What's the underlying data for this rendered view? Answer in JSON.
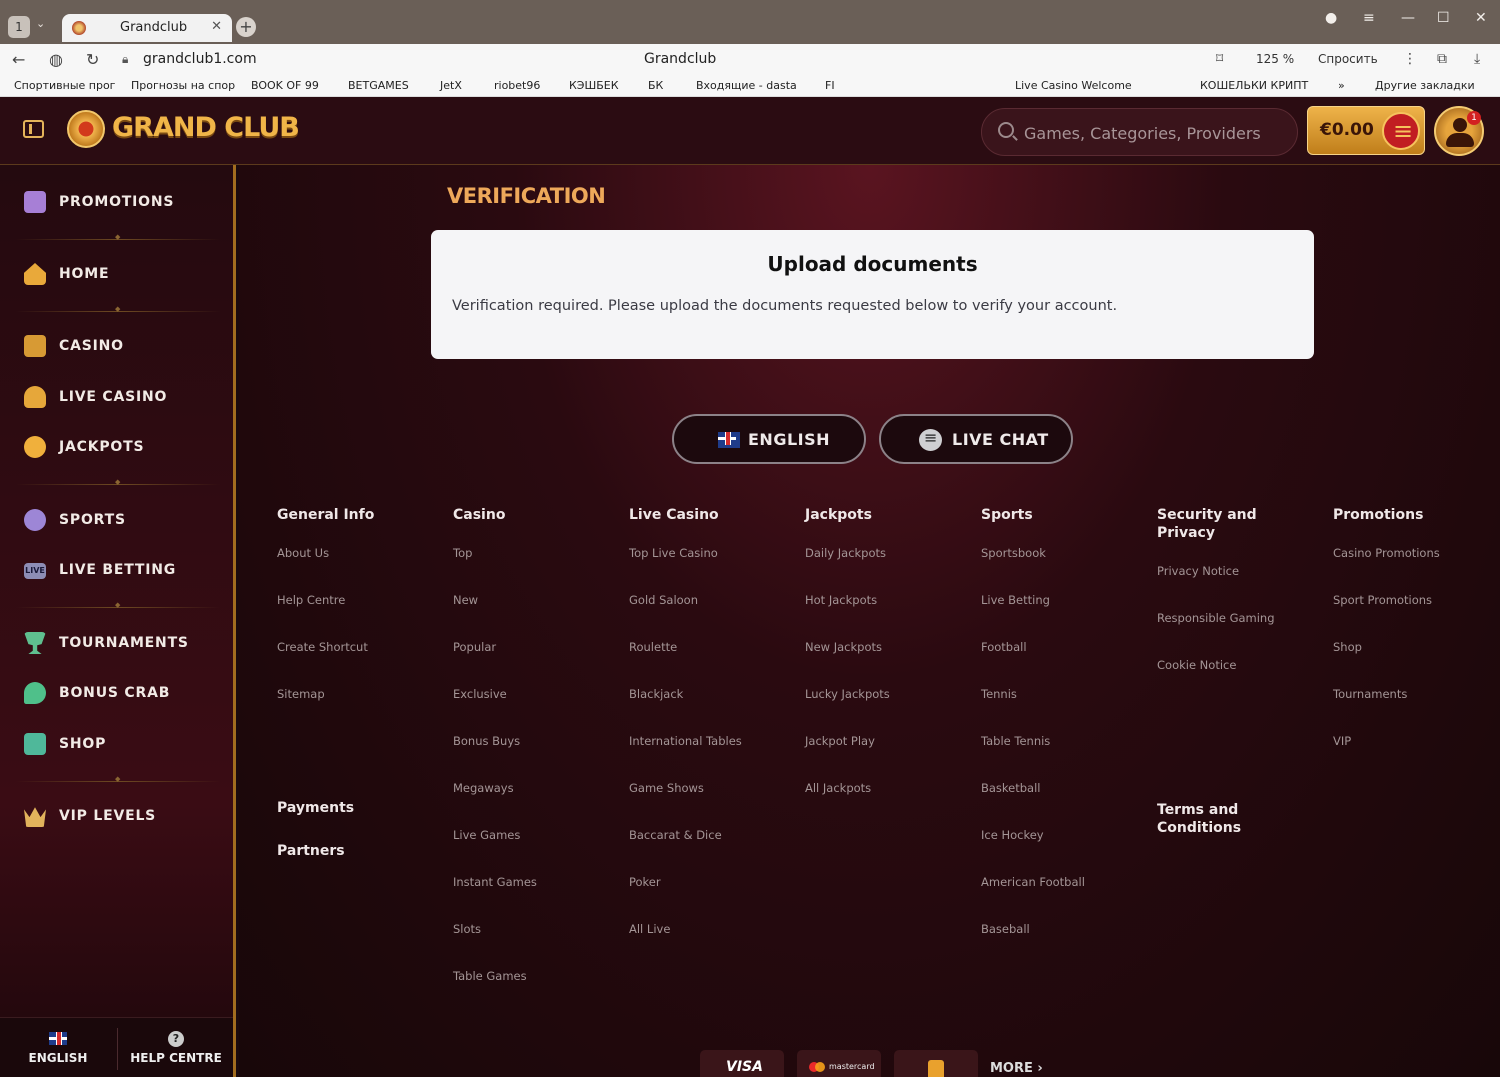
{
  "browser": {
    "tab_counter": "1",
    "tab_title": "Grandclub",
    "url": "grandclub1.com",
    "page_title": "Grandclub",
    "zoom": "125 %",
    "ask_label": "Спросить",
    "bookmarks": [
      "Спортивные прог",
      "Прогнозы на спор",
      "BOOK OF 99",
      "BETGAMES",
      "JetX",
      "riobet96",
      "КЭШБЕК",
      "БК",
      "Входящие - dasta",
      "FI",
      "Live Casino Welcome",
      "КОШЕЛЬКИ КРИПТ",
      "»",
      "Другие закладки"
    ]
  },
  "header": {
    "logo_text": "GRAND CLUB",
    "search_placeholder": "Games, Categories, Providers",
    "balance": "€0.00",
    "notification_count": "1"
  },
  "sidebar": {
    "items": [
      {
        "label": "PROMOTIONS",
        "icon": "gift-icon"
      },
      {
        "label": "HOME",
        "icon": "home-icon"
      },
      {
        "label": "CASINO",
        "icon": "slot-machine-icon"
      },
      {
        "label": "LIVE CASINO",
        "icon": "spade-icon"
      },
      {
        "label": "JACKPOTS",
        "icon": "clover-icon"
      },
      {
        "label": "SPORTS",
        "icon": "soccer-ball-icon"
      },
      {
        "label": "LIVE BETTING",
        "icon": "live-icon"
      },
      {
        "label": "TOURNAMENTS",
        "icon": "trophy-icon"
      },
      {
        "label": "BONUS CRAB",
        "icon": "crab-icon"
      },
      {
        "label": "SHOP",
        "icon": "shop-icon"
      },
      {
        "label": "VIP LEVELS",
        "icon": "crown-icon"
      }
    ],
    "live_badge": "LIVE",
    "footer_language": "ENGLISH",
    "footer_help": "HELP CENTRE",
    "help_glyph": "?"
  },
  "main": {
    "page_title": "VERIFICATION",
    "card_title": "Upload documents",
    "card_text": "Verification required. Please upload the documents requested below to verify your account.",
    "language_button": "ENGLISH",
    "chat_button": "LIVE CHAT"
  },
  "footer": {
    "columns": [
      {
        "title": "General Info",
        "links": [
          "About Us",
          "Help Centre",
          "Create Shortcut",
          "Sitemap"
        ]
      },
      {
        "title": "Casino",
        "links": [
          "Top",
          "New",
          "Popular",
          "Exclusive",
          "Bonus Buys",
          "Megaways",
          "Live Games",
          "Instant Games",
          "Slots",
          "Table Games"
        ]
      },
      {
        "title": "Live Casino",
        "links": [
          "Top Live Casino",
          "Gold Saloon",
          "Roulette",
          "Blackjack",
          "International Tables",
          "Game Shows",
          "Baccarat & Dice",
          "Poker",
          "All Live"
        ]
      },
      {
        "title": "Jackpots",
        "links": [
          "Daily Jackpots",
          "Hot Jackpots",
          "New Jackpots",
          "Lucky Jackpots",
          "Jackpot Play",
          "All Jackpots"
        ]
      },
      {
        "title": "Sports",
        "links": [
          "Sportsbook",
          "Live Betting",
          "Football",
          "Tennis",
          "Table Tennis",
          "Basketball",
          "Ice Hockey",
          "American Football",
          "Baseball"
        ]
      },
      {
        "title": "Security and Privacy",
        "links": [
          "Privacy Notice",
          "Responsible Gaming",
          "Cookie Notice"
        ]
      },
      {
        "title": "Promotions",
        "links": [
          "Casino Promotions",
          "Sport Promotions",
          "Shop",
          "Tournaments",
          "VIP"
        ]
      }
    ],
    "payments": "Payments",
    "partners": "Partners",
    "terms": "Terms and Conditions",
    "payment_logos": [
      "VISA",
      "mastercard"
    ],
    "more": "MORE"
  },
  "colors": {
    "accent_gold": "#eea95a",
    "background": "#1a0a0e",
    "card": "#f5f5f7"
  }
}
